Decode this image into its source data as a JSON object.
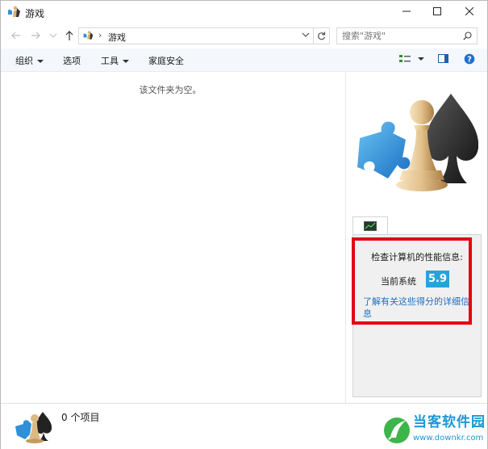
{
  "window": {
    "title": "游戏"
  },
  "address": {
    "crumb": "游戏"
  },
  "search": {
    "placeholder": "搜索\"游戏\""
  },
  "commands": {
    "organize": "组织",
    "options": "选项",
    "tools": "工具",
    "family_safety": "家庭安全"
  },
  "content": {
    "empty_message": "该文件夹为空。"
  },
  "preview": {
    "info_title": "检查计算机的性能信息:",
    "current_system_label": "当前系统",
    "score": "5.9",
    "score_link": "了解有关这些得分的详细信息"
  },
  "details": {
    "item_count": "0 个项目"
  },
  "watermark": {
    "title": "当客软件园",
    "url": "www.downkr.com"
  },
  "colors": {
    "accent": "#29a2dc",
    "highlight": "#e30613",
    "link": "#1e6fbf"
  }
}
